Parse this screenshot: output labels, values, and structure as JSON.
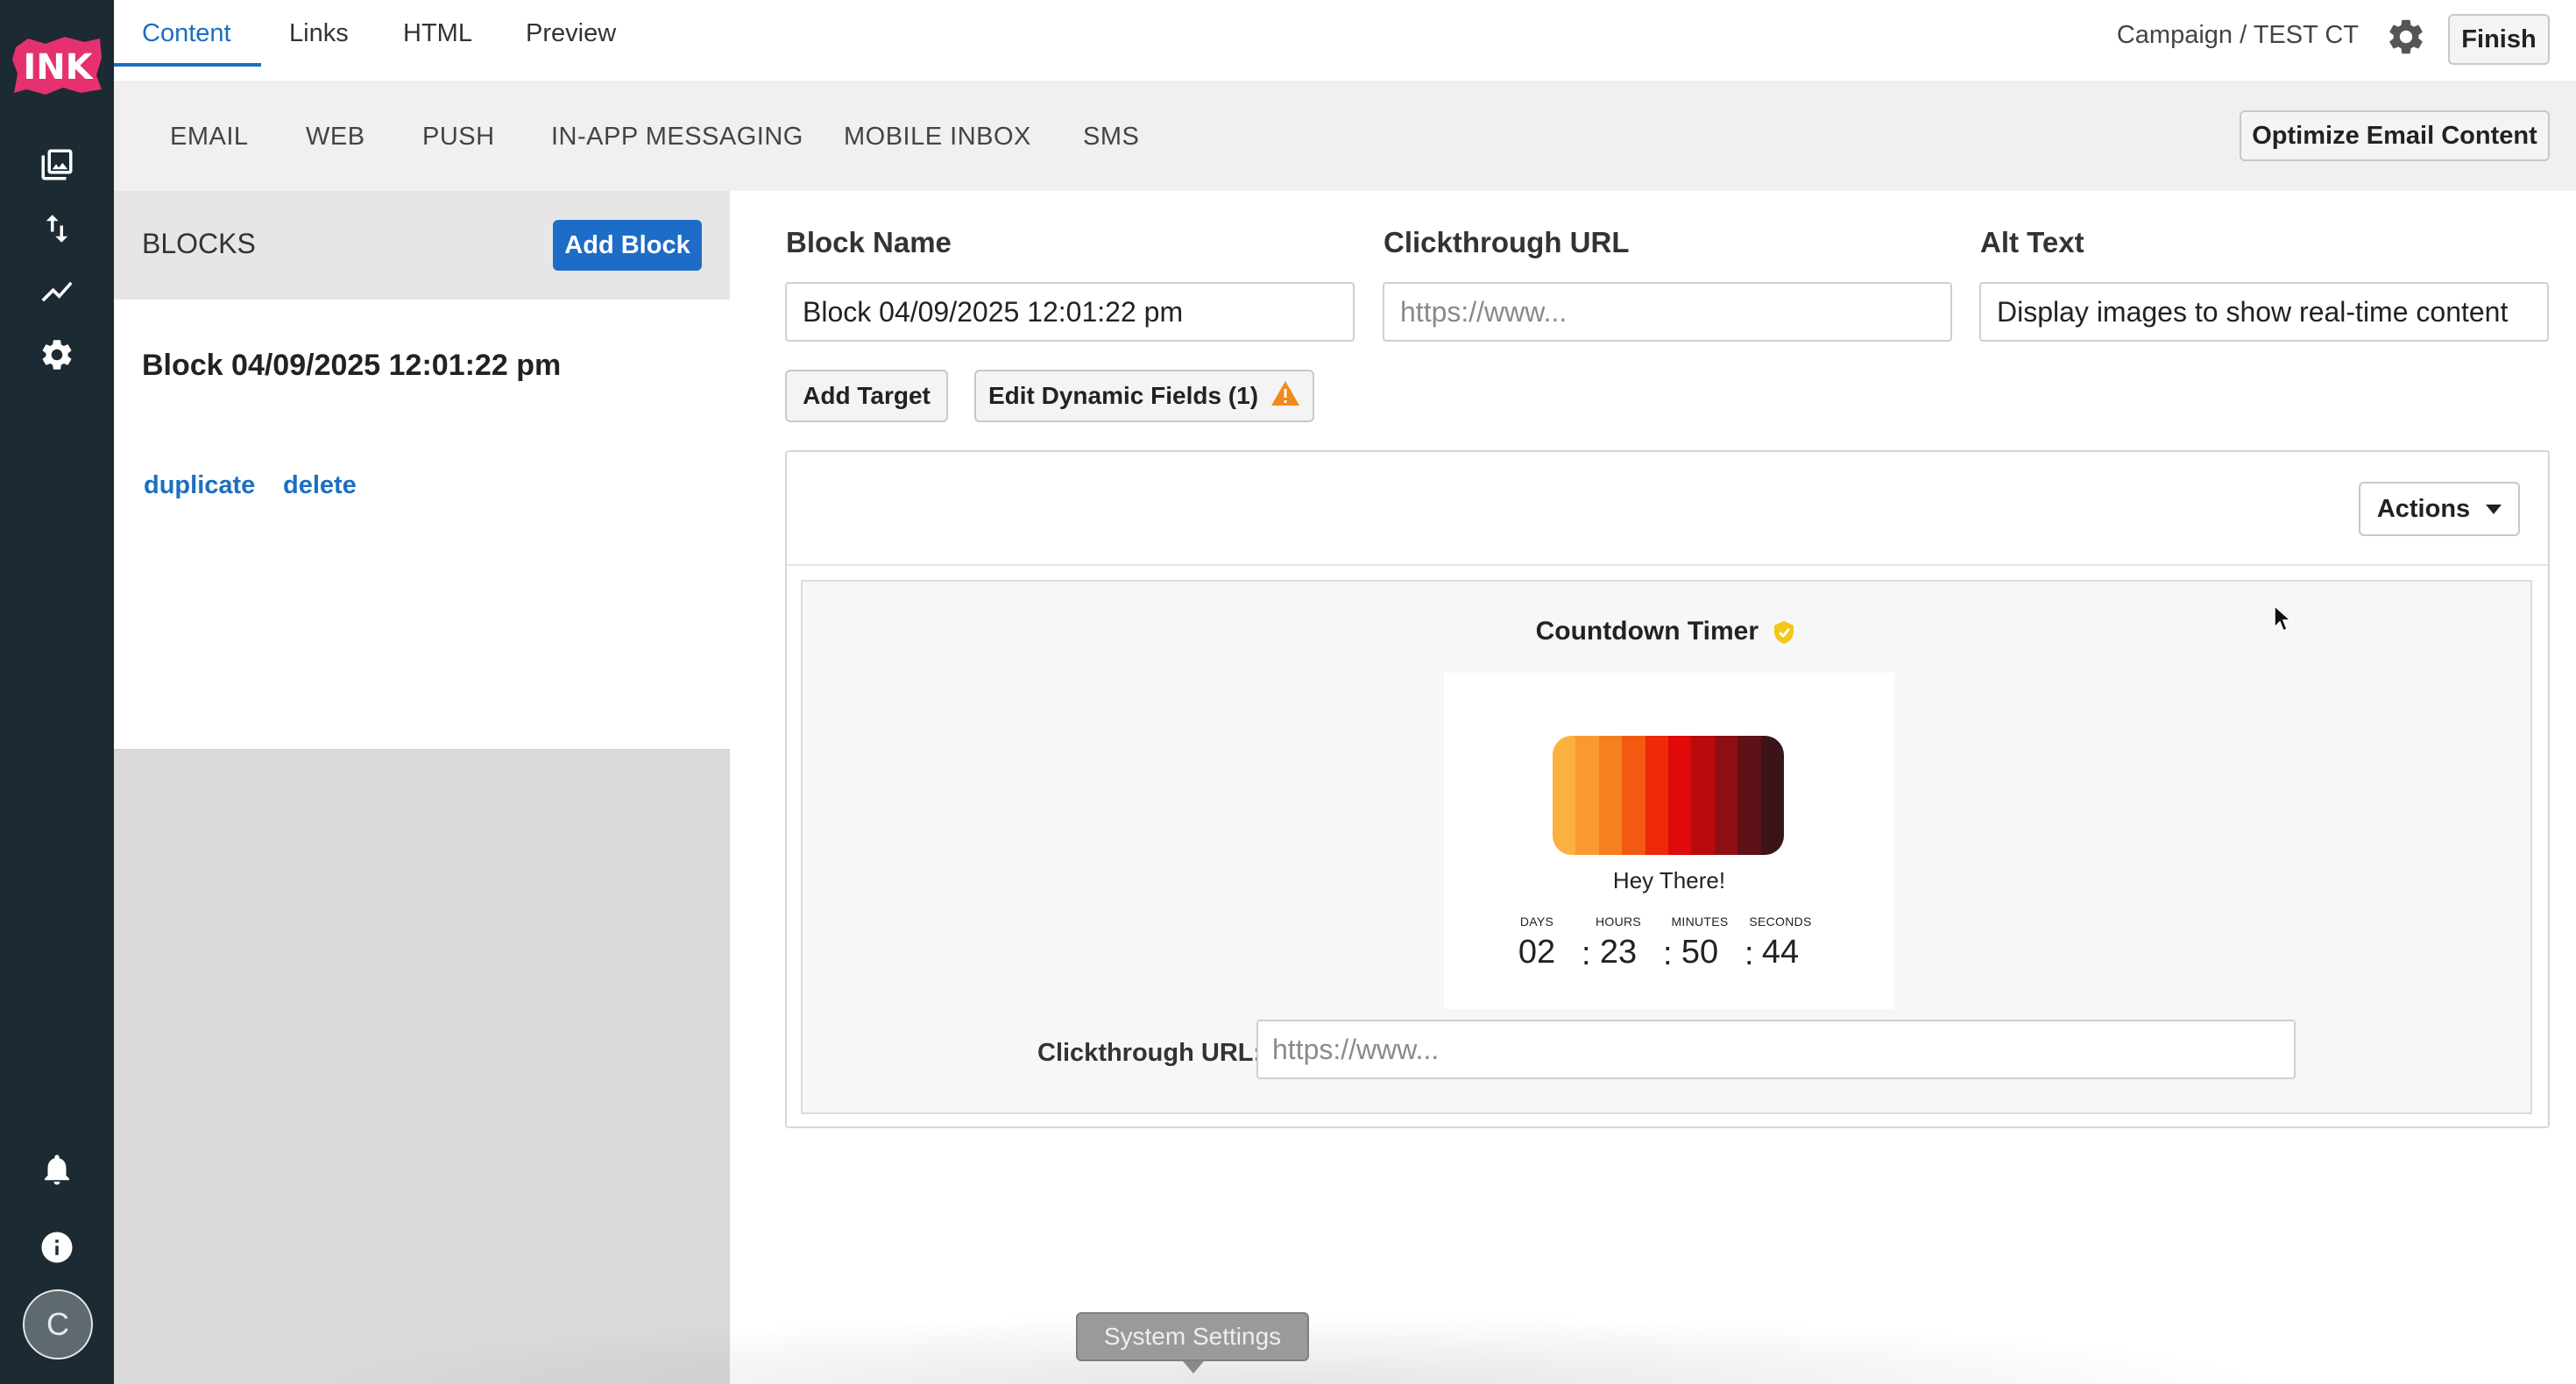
{
  "app": {
    "logo_text": "INK",
    "avatar_initial": "C"
  },
  "top_tabs": [
    {
      "label": "Content"
    },
    {
      "label": "Links"
    },
    {
      "label": "HTML"
    },
    {
      "label": "Preview"
    }
  ],
  "header": {
    "breadcrumb": "Campaign / TEST CT",
    "finish_label": "Finish"
  },
  "channels": [
    {
      "label": "EMAIL"
    },
    {
      "label": "WEB"
    },
    {
      "label": "PUSH"
    },
    {
      "label": "IN-APP MESSAGING"
    },
    {
      "label": "MOBILE INBOX"
    },
    {
      "label": "SMS"
    }
  ],
  "optimize_label": "Optimize Email Content",
  "blocks": {
    "title": "BLOCKS",
    "add_label": "Add Block",
    "items": [
      {
        "name": "Block 04/09/2025 12:01:22 pm",
        "duplicate": "duplicate",
        "delete": "delete"
      }
    ]
  },
  "editor": {
    "block_name_label": "Block Name",
    "block_name_value": "Block 04/09/2025 12:01:22 pm",
    "clickthrough_label": "Clickthrough URL",
    "clickthrough_placeholder": "https://www...",
    "alt_text_label": "Alt Text",
    "alt_text_value": "Display images to show real-time content",
    "add_target_label": "Add Target",
    "edit_dynamic_label": "Edit Dynamic Fields (1)",
    "actions_label": "Actions"
  },
  "timer": {
    "title": "Countdown Timer",
    "greeting": "Hey There!",
    "stripe_colors": [
      "#fbb040",
      "#f99a31",
      "#f5801f",
      "#f25a12",
      "#ee2a0b",
      "#e00a0a",
      "#b90b0b",
      "#8e0f13",
      "#5e1116",
      "#3a1418"
    ],
    "units": [
      {
        "label": "DAYS",
        "value": "02"
      },
      {
        "label": "HOURS",
        "value": "23"
      },
      {
        "label": "MINUTES",
        "value": "50"
      },
      {
        "label": "SECONDS",
        "value": "44"
      }
    ],
    "separator": ":",
    "url_label": "Clickthrough URL:",
    "url_placeholder": "https://www..."
  },
  "tooltip": {
    "label": "System Settings"
  },
  "colors": {
    "accent": "#1b6ec2",
    "rail": "#1b2a33",
    "primary_button": "#1d6cc8",
    "warning": "#f08a1c"
  },
  "icons": {
    "rail": [
      "image-icon",
      "sort-arrows-icon",
      "trend-line-icon",
      "gear-icon",
      "bell-icon",
      "info-icon"
    ],
    "header": [
      "gear-icon"
    ]
  }
}
